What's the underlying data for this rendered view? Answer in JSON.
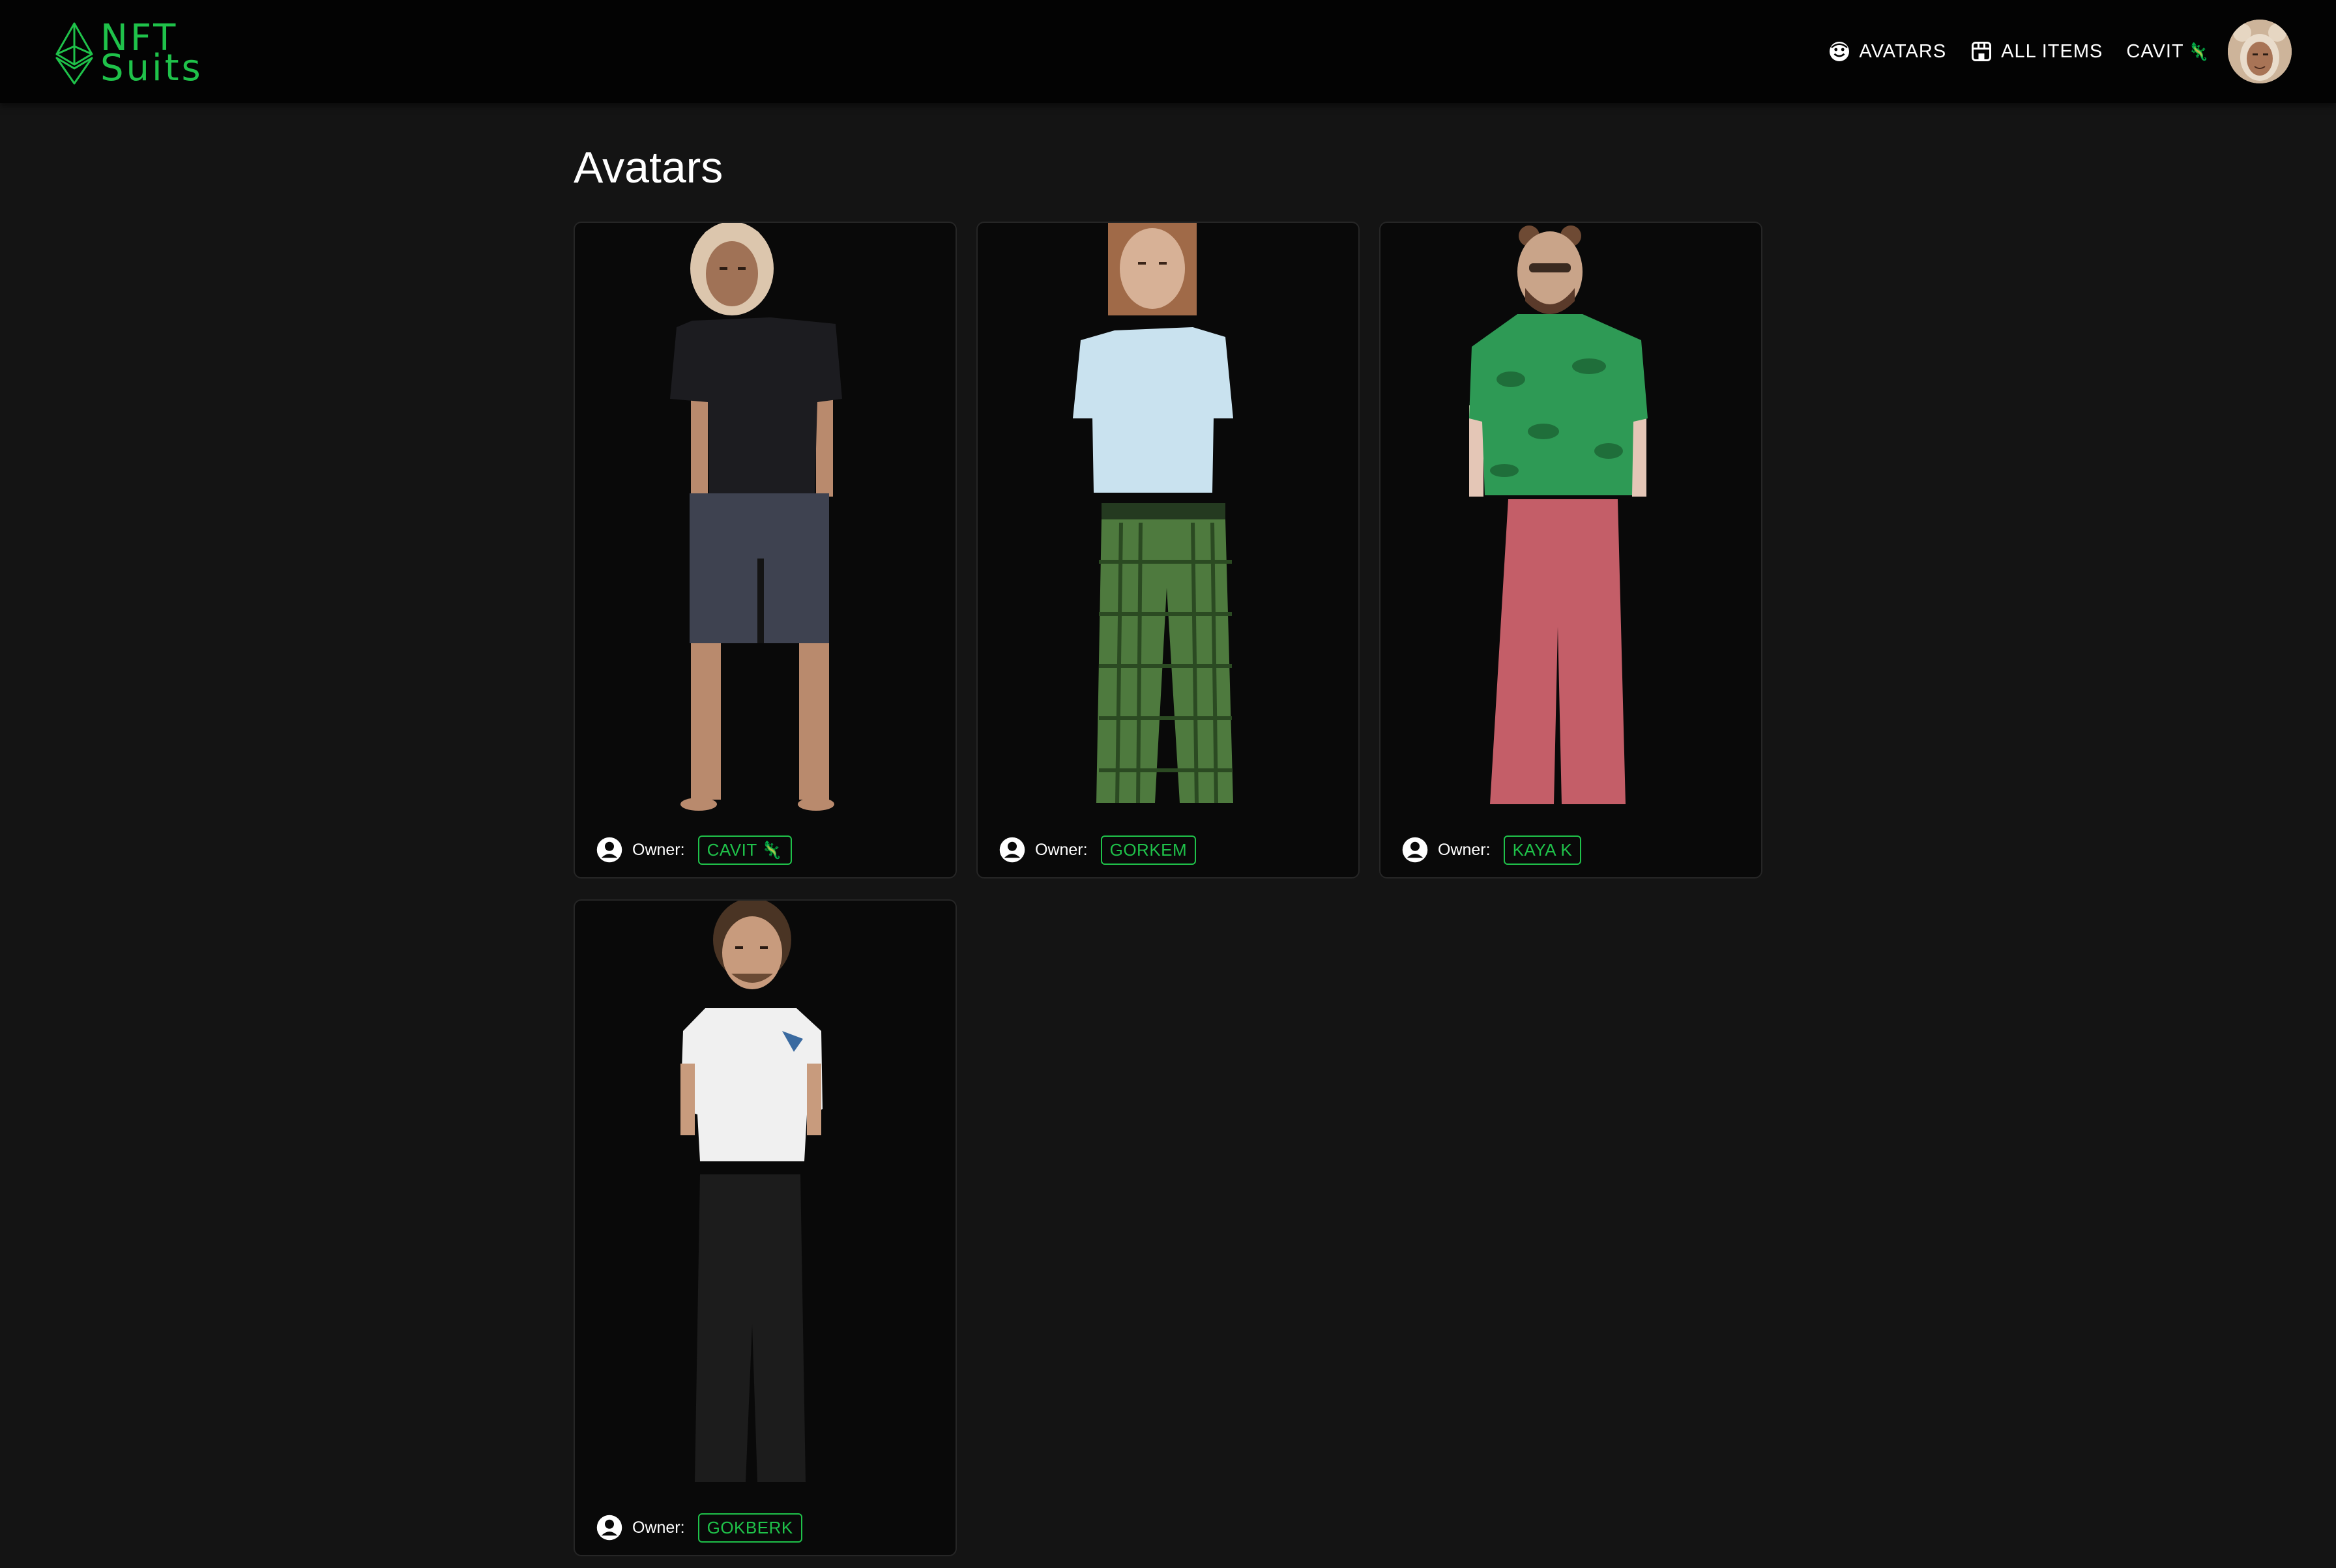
{
  "brand": {
    "line1": "NFT",
    "line2": "Suits",
    "accent": "#1fc24a"
  },
  "nav": {
    "avatars_label": "AVATARS",
    "all_items_label": "ALL ITEMS",
    "user_label": "CAVIT",
    "user_emoji": "🦎"
  },
  "page": {
    "title": "Avatars"
  },
  "owner_label": "Owner:",
  "cards": [
    {
      "owner": "CAVIT",
      "owner_emoji": "🦎",
      "shirt": "#1c1c20",
      "pants": "#3e4250",
      "pants_style": "shorts"
    },
    {
      "owner": "GORKEM",
      "owner_emoji": "",
      "shirt": "#c9e2ef",
      "pants": "#4e7a3e",
      "pants_style": "plaid"
    },
    {
      "owner": "KAYA K",
      "owner_emoji": "",
      "shirt": "#2e9a55",
      "pants": "#c45e68",
      "pants_style": "flare"
    },
    {
      "owner": "GOKBERK",
      "owner_emoji": "",
      "shirt": "#f0f0f0",
      "pants": "#1c1c1c",
      "pants_style": "long"
    }
  ]
}
